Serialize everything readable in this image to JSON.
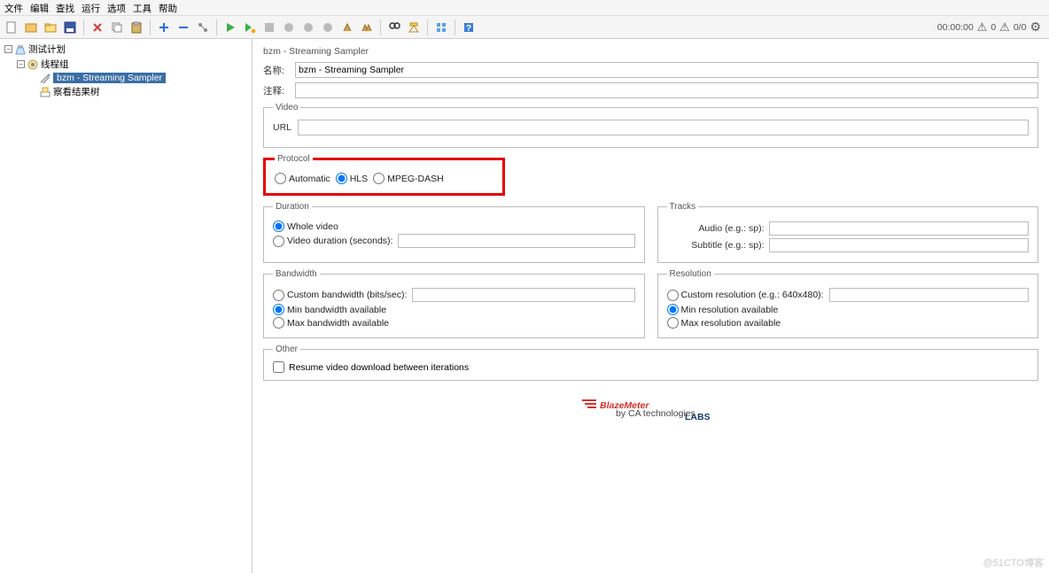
{
  "menu": {
    "items": [
      "文件",
      "编辑",
      "查找",
      "运行",
      "选项",
      "工具",
      "帮助"
    ]
  },
  "toolbar_right": {
    "time": "00:00:00",
    "warn_count": "0",
    "err_count": "0/0"
  },
  "tree": {
    "root": {
      "label": "测试计划"
    },
    "group": {
      "label": "线程组"
    },
    "sampler": {
      "label": "bzm - Streaming Sampler"
    },
    "results": {
      "label": "察看结果树"
    }
  },
  "panel": {
    "title": "bzm - Streaming Sampler",
    "name_label": "名称:",
    "name_value": "bzm - Streaming Sampler",
    "comment_label": "注释:",
    "comment_value": "",
    "video_legend": "Video",
    "url_label": "URL",
    "url_value": "",
    "protocol_legend": "Protocol",
    "protocol_automatic": "Automatic",
    "protocol_hls": "HLS",
    "protocol_mpeg": "MPEG-DASH",
    "duration_legend": "Duration",
    "duration_whole": "Whole video",
    "duration_secs": "Video duration (seconds):",
    "duration_value": "",
    "tracks_legend": "Tracks",
    "track_audio": "Audio (e.g.: sp):",
    "track_audio_value": "",
    "track_sub": "Subtitle (e.g.: sp):",
    "track_sub_value": "",
    "bandwidth_legend": "Bandwidth",
    "bw_custom": "Custom bandwidth (bits/sec):",
    "bw_custom_value": "",
    "bw_min": "Min bandwidth available",
    "bw_max": "Max bandwidth available",
    "resolution_legend": "Resolution",
    "res_custom": "Custom resolution (e.g.: 640x480):",
    "res_custom_value": "",
    "res_min": "Min resolution available",
    "res_max": "Max resolution available",
    "other_legend": "Other",
    "other_resume": "Resume video download between iterations"
  },
  "logo": {
    "brand": "BlazeMeter",
    "sub": "by CA technologies",
    "labs": "LABS"
  },
  "watermark": "@51CTO博客"
}
